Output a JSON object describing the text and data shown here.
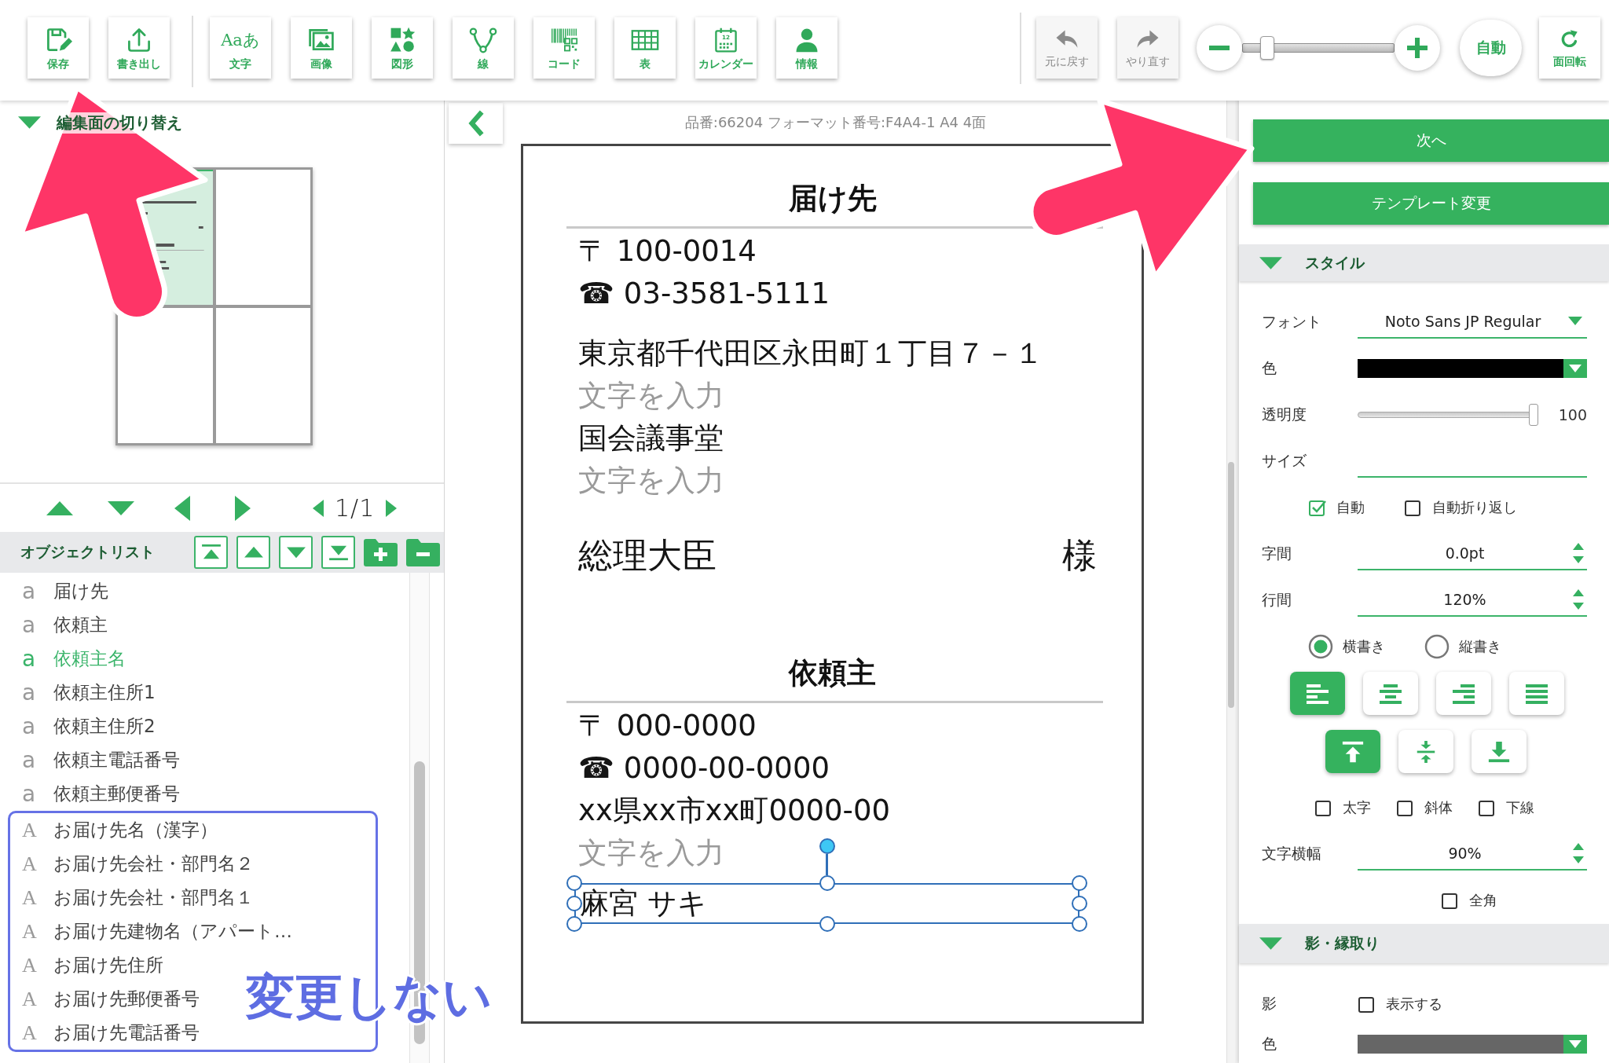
{
  "toolbar": {
    "tools": [
      {
        "label": "保存"
      },
      {
        "label": "書き出し"
      },
      {
        "label": "文字",
        "icon_text": "Aaあ"
      },
      {
        "label": "画像"
      },
      {
        "label": "図形"
      },
      {
        "label": "線"
      },
      {
        "label": "コード"
      },
      {
        "label": "表"
      },
      {
        "label": "カレンダー",
        "icon_text": "12"
      },
      {
        "label": "情報"
      }
    ],
    "history": [
      {
        "label": "元に戻す",
        "disabled": true
      },
      {
        "label": "やり直す",
        "disabled": true
      }
    ],
    "zoom": {
      "level": 0.13
    },
    "auto_button": "自動",
    "rotate_button": "面回転"
  },
  "left_panel": {
    "faces_section": {
      "title": "編集面の切り替え",
      "expanded": true,
      "faces": [
        {
          "selected": true,
          "filled": true
        },
        {
          "selected": false,
          "filled": false
        },
        {
          "selected": false,
          "filled": false
        },
        {
          "selected": false,
          "filled": false
        }
      ]
    },
    "pager": {
      "page": "1/1"
    },
    "object_list": {
      "title": "オブジェクトリスト",
      "items": [
        {
          "icon": "a",
          "label": "届け先",
          "kind": "variable",
          "selected": false
        },
        {
          "icon": "a",
          "label": "依頼主",
          "kind": "variable",
          "selected": false
        },
        {
          "icon": "a",
          "label": "依頼主名",
          "kind": "variable",
          "selected": true
        },
        {
          "icon": "a",
          "label": "依頼主住所1",
          "kind": "variable",
          "selected": false
        },
        {
          "icon": "a",
          "label": "依頼主住所2",
          "kind": "variable",
          "selected": false
        },
        {
          "icon": "a",
          "label": "依頼主電話番号",
          "kind": "variable",
          "selected": false
        },
        {
          "icon": "a",
          "label": "依頼主郵便番号",
          "kind": "variable",
          "selected": false
        },
        {
          "icon": "A",
          "label": "お届け先名（漢字）",
          "kind": "fixed",
          "selected": false
        },
        {
          "icon": "A",
          "label": "お届け先会社・部門名２",
          "kind": "fixed",
          "selected": false
        },
        {
          "icon": "A",
          "label": "お届け先会社・部門名１",
          "kind": "fixed",
          "selected": false
        },
        {
          "icon": "A",
          "label": "お届け先建物名（アパート…",
          "kind": "fixed",
          "selected": false
        },
        {
          "icon": "A",
          "label": "お届け先住所",
          "kind": "fixed",
          "selected": false
        },
        {
          "icon": "A",
          "label": "お届け先郵便番号",
          "kind": "fixed",
          "selected": false
        },
        {
          "icon": "A",
          "label": "お届け先電話番号",
          "kind": "fixed",
          "selected": false
        }
      ]
    }
  },
  "canvas": {
    "info": "品番:66204 フォーマット番号:F4A4-1 A4 4面",
    "sections": [
      {
        "heading": "届け先",
        "lines": [
          {
            "value": "〒 100-0014",
            "selected": false
          },
          {
            "value": "☎ 03-3581-5111",
            "selected": false
          },
          {
            "value": "東京都千代田区永田町１丁目７－１",
            "selected": false
          },
          {
            "placeholder": "文字を入力",
            "selected": false
          },
          {
            "value": "国会議事堂",
            "selected": false
          },
          {
            "placeholder": "文字を入力",
            "selected": false
          },
          {
            "value": "総理大臣",
            "honorific": "様",
            "selected": false
          }
        ]
      },
      {
        "heading": "依頼主",
        "lines": [
          {
            "value": "〒 000-0000",
            "selected": false
          },
          {
            "value": "☎ 0000-00-0000",
            "selected": false
          },
          {
            "value": "xx県xx市xx町0000-00",
            "selected": false
          },
          {
            "placeholder": "文字を入力",
            "selected": false
          },
          {
            "value": "麻宮 サキ",
            "selected": true
          }
        ]
      }
    ]
  },
  "right_panel": {
    "actions": [
      {
        "label": "次へ"
      },
      {
        "label": "テンプレート変更"
      }
    ],
    "style": {
      "title": "スタイル",
      "expanded": true,
      "font": {
        "label": "フォント",
        "value": "Noto Sans JP Regular"
      },
      "color": {
        "label": "色",
        "color": "#000000"
      },
      "opacity": {
        "label": "透明度",
        "level": 1,
        "reading": "100"
      },
      "size": {
        "label": "サイズ"
      },
      "size_options": [
        {
          "label": "自動",
          "checked": true
        },
        {
          "label": "自動折り返し",
          "checked": false
        }
      ],
      "letter_spacing": {
        "label": "字間",
        "value": "0.0pt"
      },
      "line_spacing": {
        "label": "行間",
        "value": "120%"
      },
      "direction": [
        {
          "label": "横書き",
          "selected": true
        },
        {
          "label": "縦書き",
          "selected": false
        }
      ],
      "align": [
        {
          "selected": true
        },
        {
          "selected": false
        },
        {
          "selected": false
        },
        {
          "selected": false
        }
      ],
      "vertical_align": [
        {
          "selected": true
        },
        {
          "selected": false
        },
        {
          "selected": false
        }
      ],
      "decorations": [
        {
          "label": "太字",
          "checked": false
        },
        {
          "label": "斜体",
          "checked": false
        },
        {
          "label": "下線",
          "checked": false
        }
      ],
      "char_width": {
        "label": "文字横幅",
        "value": "90%"
      },
      "full_width": {
        "label": "全角",
        "checked": false
      }
    },
    "shadow": {
      "title": "影・縁取り",
      "expanded": true,
      "shadow": {
        "label": "影",
        "option": {
          "label": "表示する",
          "checked": false
        }
      },
      "color": {
        "label": "色",
        "color": "#666666"
      }
    }
  },
  "annotation": {
    "note": "変更しない"
  }
}
